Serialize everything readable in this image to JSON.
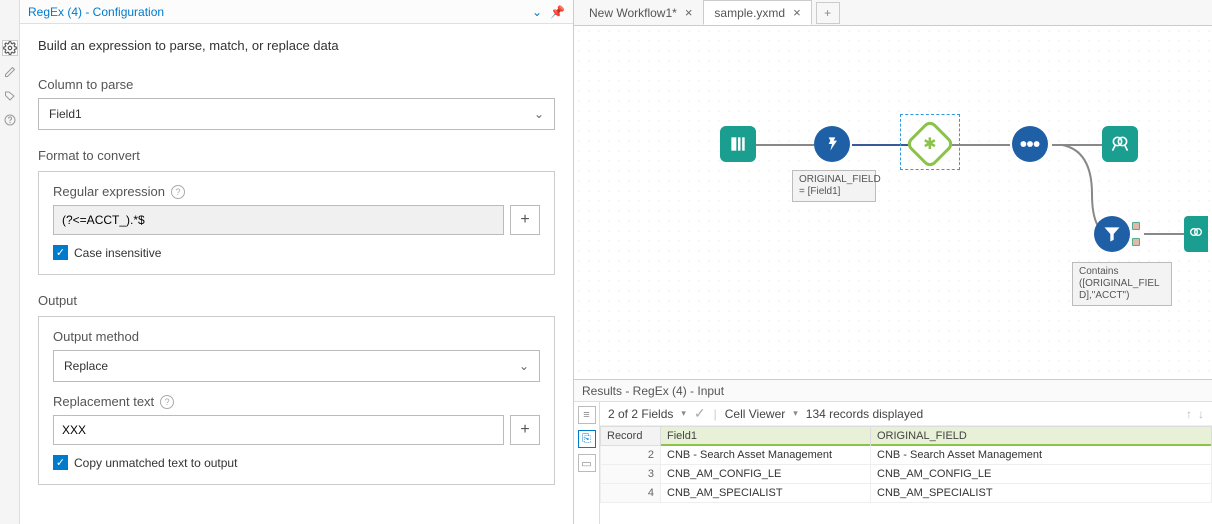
{
  "config": {
    "title": "RegEx (4) - Configuration",
    "instruction": "Build an expression to parse, match, or replace data",
    "column_to_parse_label": "Column to parse",
    "column_to_parse_value": "Field1",
    "format_to_convert_label": "Format to convert",
    "regex_label": "Regular expression",
    "regex_value": "(?<=ACCT_).*$",
    "case_insensitive_label": "Case insensitive",
    "output_label": "Output",
    "output_method_label": "Output method",
    "output_method_value": "Replace",
    "replacement_text_label": "Replacement text",
    "replacement_text_value": "XXX",
    "copy_unmatched_label": "Copy unmatched text to output"
  },
  "tabs": [
    {
      "label": "New Workflow1*",
      "active": false
    },
    {
      "label": "sample.yxmd",
      "active": true
    }
  ],
  "canvas": {
    "formula_annotation": "ORIGINAL_FIELD\n= [Field1]",
    "filter_annotation": "Contains\n([ORIGINAL_FIEL\nD],\"ACCT\")"
  },
  "results": {
    "header": "Results - RegEx (4) - Input",
    "fields_text": "2 of 2 Fields",
    "cell_viewer_text": "Cell Viewer",
    "records_text": "134 records displayed",
    "columns": [
      "Record",
      "Field1",
      "ORIGINAL_FIELD"
    ],
    "rows": [
      {
        "rec": "2",
        "f1": "CNB - Search Asset Management",
        "of": "CNB - Search Asset Management"
      },
      {
        "rec": "3",
        "f1": "CNB_AM_CONFIG_LE",
        "of": "CNB_AM_CONFIG_LE"
      },
      {
        "rec": "4",
        "f1": "CNB_AM_SPECIALIST",
        "of": "CNB_AM_SPECIALIST"
      }
    ]
  }
}
